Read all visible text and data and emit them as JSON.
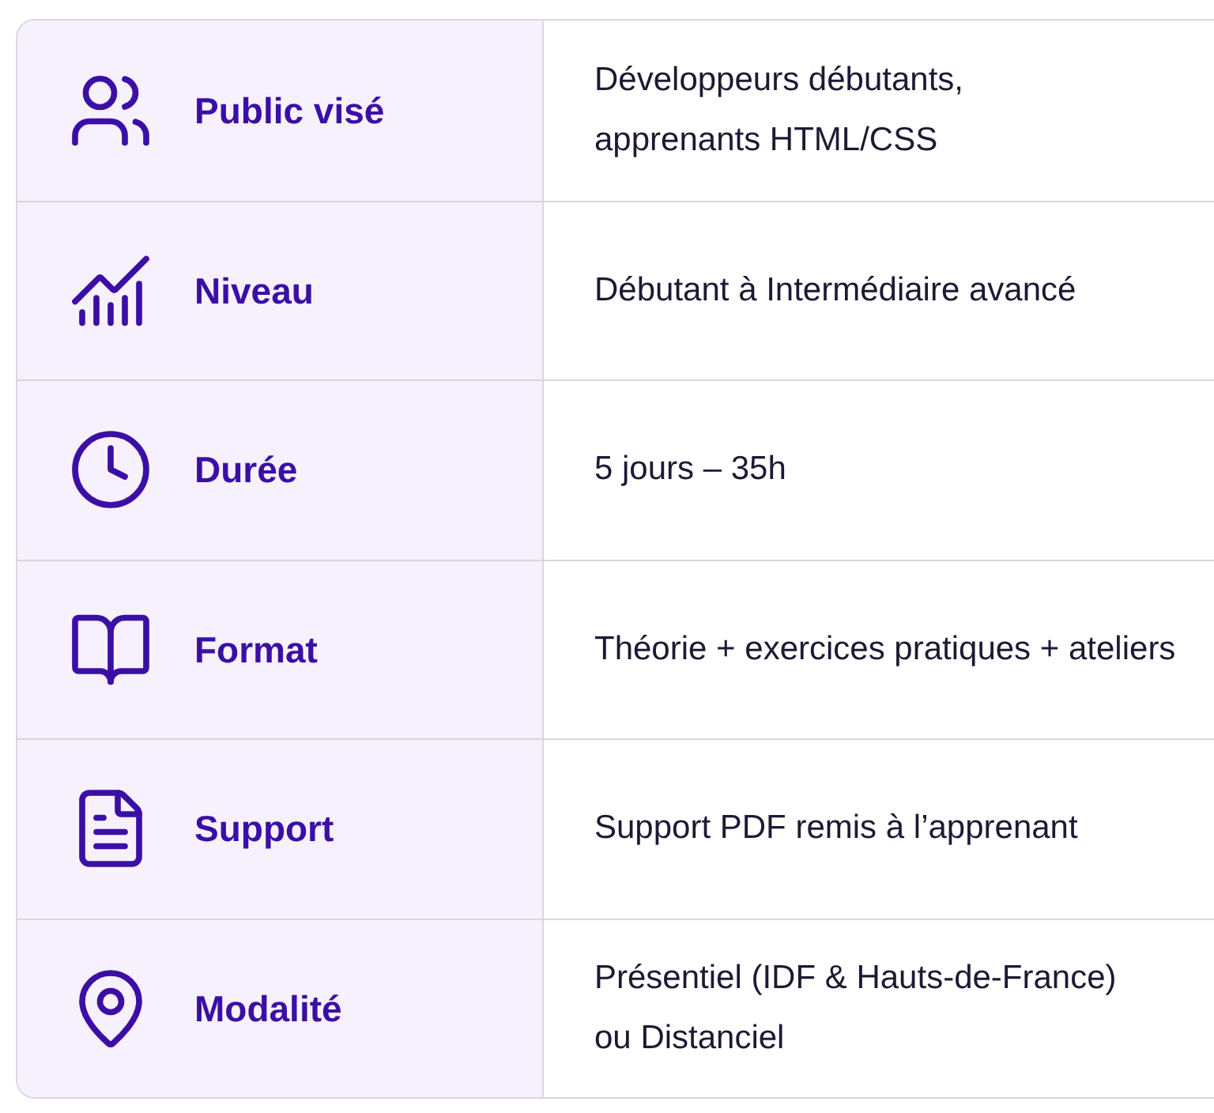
{
  "rows": [
    {
      "label": "Public visé",
      "value": "Développeurs débutants,\napprenants HTML/CSS"
    },
    {
      "label": "Niveau",
      "value": "Débutant à Intermédiaire avancé"
    },
    {
      "label": "Durée",
      "value": "5 jours – 35h"
    },
    {
      "label": "Format",
      "value": "Théorie + exercices pratiques + ateliers"
    },
    {
      "label": "Support",
      "value": "Support PDF remis à l’apprenant"
    },
    {
      "label": "Modalité",
      "value": "Présentiel (IDF & Hauts-de-France)\nou Distanciel"
    }
  ]
}
